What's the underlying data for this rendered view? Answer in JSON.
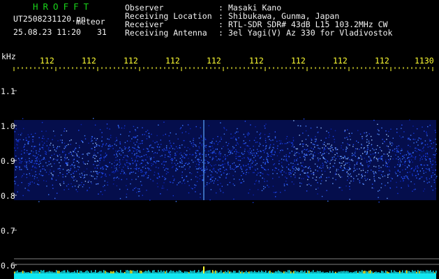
{
  "app": {
    "brand": "HROFFT",
    "filename": "UT2508231120.pn",
    "event_label": "meteor",
    "datetime": "25.08.23 11:20",
    "seconds": "31"
  },
  "header": {
    "rows": [
      {
        "label": "Observer",
        "value": "Masaki Kano"
      },
      {
        "label": "Receiving Location",
        "value": "Shibukawa, Gunma, Japan"
      },
      {
        "label": "Receiver",
        "value": "RTL-SDR SDR# 43dB L15 103.2MHz CW"
      },
      {
        "label": "Receiving Antenna",
        "value": "3el Yagi(V) Az 330 for Vladivostok"
      }
    ]
  },
  "axes": {
    "y_unit": "kHz",
    "x_ticks": [
      "112",
      "112",
      "112",
      "112",
      "112",
      "112",
      "112",
      "112",
      "112",
      "1130"
    ],
    "y_ticks": [
      "1.1",
      "1.0",
      "0.9",
      "0.8",
      "0.7",
      "0.6"
    ]
  },
  "colors": {
    "brand": "#19d419",
    "text": "#f2f2f2",
    "ticks": "#ffff33",
    "noise_low": "#0a1a8a",
    "noise_high": "#3f7bff",
    "baseline": "#12e6f0"
  }
}
